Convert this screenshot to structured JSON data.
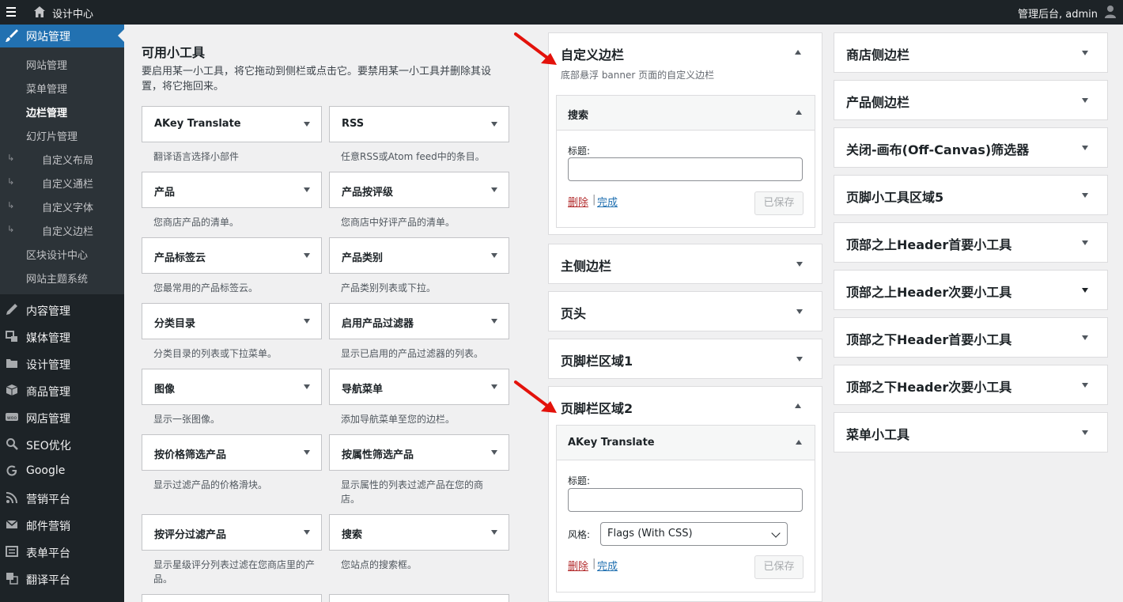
{
  "adminbar": {
    "site_name": "设计中心",
    "account": "管理后台, admin"
  },
  "sidebar": {
    "current": "网站管理",
    "submenu": [
      {
        "label": "网站管理",
        "active": false,
        "nested": false
      },
      {
        "label": "菜单管理",
        "active": false,
        "nested": false
      },
      {
        "label": "边栏管理",
        "active": true,
        "nested": false
      },
      {
        "label": "幻灯片管理",
        "active": false,
        "nested": false
      },
      {
        "label": "自定义布局",
        "active": false,
        "nested": true
      },
      {
        "label": "自定义通栏",
        "active": false,
        "nested": true
      },
      {
        "label": "自定义字体",
        "active": false,
        "nested": true
      },
      {
        "label": "自定义边栏",
        "active": false,
        "nested": true
      },
      {
        "label": "区块设计中心",
        "active": false,
        "nested": false
      },
      {
        "label": "网站主题系统",
        "active": false,
        "nested": false
      }
    ],
    "nested_marker": "↳",
    "menu": [
      {
        "label": "内容管理",
        "icon": "pen-icon"
      },
      {
        "label": "媒体管理",
        "icon": "media-icon"
      },
      {
        "label": "设计管理",
        "icon": "folder-icon"
      },
      {
        "label": "商品管理",
        "icon": "box-icon"
      },
      {
        "label": "网店管理",
        "icon": "woo-icon"
      },
      {
        "label": "SEO优化",
        "icon": "search-icon"
      },
      {
        "label": "Google",
        "icon": "google-icon"
      },
      {
        "label": "营销平台",
        "icon": "rss-icon"
      },
      {
        "label": "邮件营销",
        "icon": "mail-icon"
      },
      {
        "label": "表单平台",
        "icon": "form-icon"
      },
      {
        "label": "翻译平台",
        "icon": "translate-icon"
      }
    ]
  },
  "available": {
    "title": "可用小工具",
    "description": "要启用某一小工具，将它拖动到侧栏或点击它。要禁用某一小工具并删除其设置，将它拖回来。",
    "widgets": [
      {
        "title": "AKey Translate",
        "desc": "翻译语言选择小部件"
      },
      {
        "title": "RSS",
        "desc": "任意RSS或Atom feed中的条目。"
      },
      {
        "title": "产品",
        "desc": "您商店产品的清单。"
      },
      {
        "title": "产品按评级",
        "desc": "您商店中好评产品的清单。"
      },
      {
        "title": "产品标签云",
        "desc": "您最常用的产品标签云。"
      },
      {
        "title": "产品类别",
        "desc": "产品类别列表或下拉。"
      },
      {
        "title": "分类目录",
        "desc": "分类目录的列表或下拉菜单。"
      },
      {
        "title": "启用产品过滤器",
        "desc": "显示已启用的产品过滤器的列表。"
      },
      {
        "title": "图像",
        "desc": "显示一张图像。"
      },
      {
        "title": "导航菜单",
        "desc": "添加导航菜单至您的边栏。"
      },
      {
        "title": "按价格筛选产品",
        "desc": "显示过滤产品的价格滑块。"
      },
      {
        "title": "按属性筛选产品",
        "desc": "显示属性的列表过滤产品在您的商店。"
      },
      {
        "title": "按评分过滤产品",
        "desc": "显示星级评分列表过滤在您商店里的产品。"
      },
      {
        "title": "搜索",
        "desc": "您站点的搜索框。"
      }
    ]
  },
  "custom_sidebar": {
    "title": "自定义边栏",
    "description": "底部悬浮 banner 页面的自定义边栏",
    "widget_title": "搜索",
    "field_label": "标题:",
    "field_value": "",
    "delete": "删除",
    "separator": "|",
    "done": "完成",
    "saved": "已保存"
  },
  "middle_areas": [
    "主侧边栏",
    "页头",
    "页脚栏区域1"
  ],
  "footer2": {
    "title": "页脚栏区域2",
    "widget_title": "AKey Translate",
    "field_label": "标题:",
    "field_value": "",
    "style_label": "风格:",
    "style_value": "Flags (With CSS)",
    "delete": "删除",
    "separator": "|",
    "done": "完成",
    "saved": "已保存"
  },
  "right_areas": [
    "商店侧边栏",
    "产品侧边栏",
    "关闭-画布(Off-Canvas)筛选器",
    "页脚小工具区域5",
    "顶部之上Header首要小工具",
    "顶部之上Header次要小工具",
    "顶部之下Header首要小工具",
    "顶部之下Header次要小工具",
    "菜单小工具"
  ],
  "colors": {
    "accent": "#2271b1",
    "annotation_arrow": "#e3120b",
    "adminbar": "#1d2327"
  }
}
